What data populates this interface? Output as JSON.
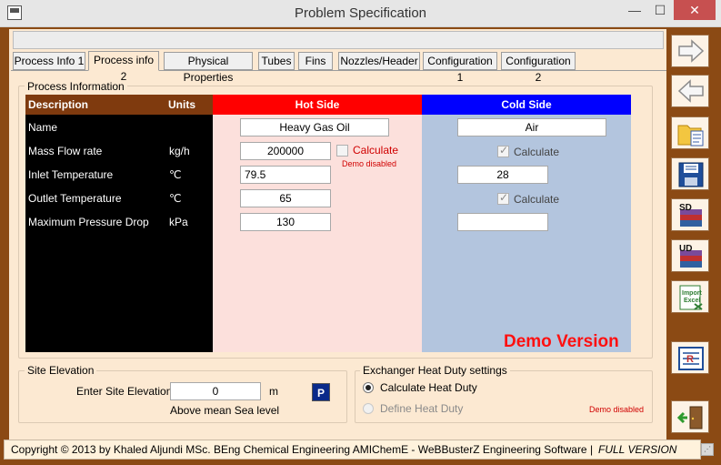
{
  "window": {
    "title": "Problem Specification",
    "minimize": "—",
    "maximize": "☐",
    "close": "✕"
  },
  "tabs": [
    {
      "label": "Process Info 1",
      "active": false
    },
    {
      "label": "Process info 2",
      "active": true
    },
    {
      "label": "Physical Properties",
      "active": false
    },
    {
      "label": "Tubes",
      "active": false
    },
    {
      "label": "Fins",
      "active": false
    },
    {
      "label": "Nozzles/Header",
      "active": false
    },
    {
      "label": "Configuration 1",
      "active": false
    },
    {
      "label": "Configuration 2",
      "active": false
    }
  ],
  "process_info": {
    "group_label": "Process Information",
    "headers": {
      "description": "Description",
      "units": "Units",
      "hot_side": "Hot Side",
      "cold_side": "Cold Side"
    },
    "rows": [
      {
        "label": "Name",
        "unit": "",
        "hot": "Heavy Gas Oil",
        "cold": "Air"
      },
      {
        "label": "Mass Flow rate",
        "unit": "kg/h",
        "hot": "200000",
        "cold": ""
      },
      {
        "label": "Inlet Temperature",
        "unit": "℃",
        "hot": "79.5",
        "cold": "28"
      },
      {
        "label": "Outlet Temperature",
        "unit": "℃",
        "hot": "65",
        "cold": ""
      },
      {
        "label": "Maximum Pressure Drop",
        "unit": "kPa",
        "hot": "130",
        "cold": ""
      }
    ],
    "hot_calculate_label": "Calculate",
    "hot_demo_disabled": "Demo disabled",
    "cold_mass_calculate_label": "Calculate",
    "cold_outlet_calculate_label": "Calculate",
    "demo_version": "Demo Version"
  },
  "site_elevation": {
    "group_label": "Site Elevation",
    "prompt": "Enter Site Elevation",
    "value": "0",
    "unit": "m",
    "note": "Above mean Sea level",
    "p_button": "P"
  },
  "heat_duty": {
    "group_label": "Exchanger Heat Duty settings",
    "calculate_label": "Calculate Heat Duty",
    "define_label": "Define Heat Duty",
    "demo_disabled": "Demo disabled",
    "selected": "Calculate Heat Duty"
  },
  "status_bar": {
    "copyright": "Copyright © 2013 by Khaled Aljundi MSc. BEng Chemical Engineering AMIChemE - WeBBusterZ Engineering Software  |",
    "version": "FULL VERSION"
  },
  "toolbar": [
    {
      "icon": "arrow-right-icon"
    },
    {
      "icon": "arrow-left-icon"
    },
    {
      "icon": "open-folder-icon"
    },
    {
      "icon": "save-disk-icon"
    },
    {
      "icon": "sd-books-icon",
      "text": "SD"
    },
    {
      "icon": "ud-books-icon",
      "text": "UD"
    },
    {
      "icon": "import-excel-icon",
      "text": "Import Excel"
    },
    {
      "icon": "report-icon"
    },
    {
      "icon": "exit-door-icon"
    }
  ],
  "colors": {
    "frame": "#8B4A14",
    "panel": "#FCE9D2",
    "hot_header": "#FF0000",
    "cold_header": "#0000FF",
    "hot_column": "#FCE0DC",
    "cold_column": "#B3C5DE",
    "demo_text": "#FF1010"
  }
}
